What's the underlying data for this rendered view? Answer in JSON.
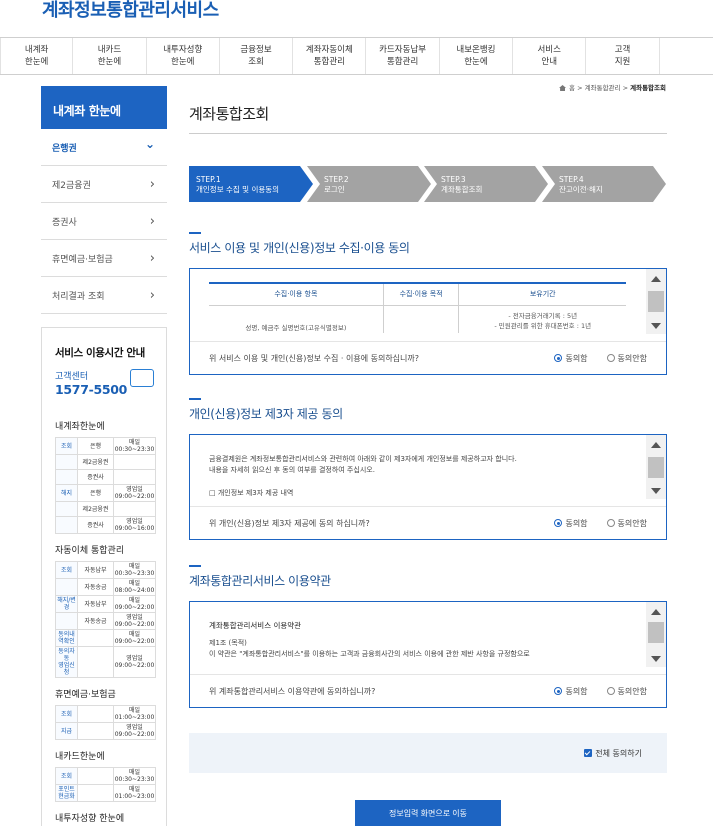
{
  "header": {
    "logo": "계좌정보통합관리서비스"
  },
  "gnb": [
    "내계좌\n한눈에",
    "내카드\n한눈에",
    "내투자성향\n한눈에",
    "금융정보\n조회",
    "계좌자동이체\n통합관리",
    "카드자동납부\n통합관리",
    "내보온뱅킹\n한눈에",
    "서비스\n안내",
    "고객\n지원"
  ],
  "lnb": {
    "title": "내계좌 한눈에",
    "items": [
      {
        "label": "은행권",
        "icon": "chevron-down"
      },
      {
        "label": "제2금융권",
        "icon": "chevron-right"
      },
      {
        "label": "증권사",
        "icon": "chevron-right"
      },
      {
        "label": "휴면예금·보험금",
        "icon": "chevron-right"
      },
      {
        "label": "처리결과 조회",
        "icon": "chevron-right"
      }
    ]
  },
  "service_info": {
    "title": "서비스 이용시간 안내",
    "cc_label": "고객센터",
    "cc_phone": "1577-5500",
    "sections": [
      {
        "title": "내계좌한눈에",
        "rows": [
          [
            "조회",
            "은행",
            "매일\n00:30~23:30"
          ],
          [
            "",
            "제2금융권",
            ""
          ],
          [
            "",
            "증권사",
            ""
          ],
          [
            "해지",
            "은행",
            "영업일\n09:00~22:00"
          ],
          [
            "",
            "제2금융권",
            ""
          ],
          [
            "",
            "증권사",
            "영업일\n09:00~16:00"
          ]
        ]
      },
      {
        "title": "자동이체 통합관리",
        "rows": [
          [
            "조회",
            "자동납부",
            "매일\n00:30~23:30"
          ],
          [
            "",
            "자동송금",
            "매일\n08:00~24:00"
          ],
          [
            "해지/변경",
            "자동납부",
            "매일\n09:00~22:00"
          ],
          [
            "",
            "자동송금",
            "영업일\n09:00~22:00"
          ],
          [
            "동의내역확인",
            "",
            "매일 09:00~22:00"
          ],
          [
            "동의자동\n영업신청",
            "",
            "영업일 09:00~22:00"
          ]
        ]
      },
      {
        "title": "휴면예금·보험금",
        "rows": [
          [
            "조회",
            "",
            "매일 01:00~23:00"
          ],
          [
            "지급",
            "",
            "영업일 09:00~22:00"
          ]
        ]
      },
      {
        "title": "내카드한눈에",
        "rows": [
          [
            "조회",
            "",
            "매일 00:30~23:30"
          ],
          [
            "포인트현금화",
            "",
            "매일 01:00~23:00"
          ]
        ]
      },
      {
        "title": "내투자성향 한눈에",
        "rows": []
      }
    ]
  },
  "breadcrumb": {
    "home": "홈",
    "mid": "계좌통합관리",
    "current": "계좌통합조회"
  },
  "page_title": "계좌통합조회",
  "steps": [
    {
      "num": "STEP.1",
      "label": "개인정보 수집 및 이용동의",
      "color": "#1d64c2"
    },
    {
      "num": "STEP.2",
      "label": "로그인",
      "color": "#a3a3a3"
    },
    {
      "num": "STEP.3",
      "label": "계좌통합조회",
      "color": "#a3a3a3"
    },
    {
      "num": "STEP.4",
      "label": "잔고이전·해지",
      "color": "#a3a3a3"
    }
  ],
  "section1": {
    "title": "서비스 이용 및 개인(신용)정보 수집·이용 동의",
    "table": {
      "headers": [
        "수집·이용 항목",
        "수집·이용 목적",
        "보유기간"
      ],
      "row": [
        "성명, 예금주 실명번호(고유식별정보)",
        "",
        "- 전자금융거래기록 : 5년\n- 민원관리를 위한 휴대폰번호 : 1년"
      ]
    },
    "question": "위 서비스 이용 및 개인(신용)정보 수집 · 이용에 동의하십니까?",
    "agree": "동의함",
    "disagree": "동의안함"
  },
  "section2": {
    "title": "개인(신용)정보 제3자 제공 동의",
    "body1": "금융결제원은 계좌정보통합관리서비스와 관련하여 아래와 같이 제3자에게 개인정보를 제공하고자 합니다.",
    "body2": "내용을 자세히 읽으신 후 동의 여부를 결정하여 주십시오.",
    "body3": "□ 개인정보 제3자 제공 내역",
    "question": "위 개인(신용)정보 제3자 제공에 동의 하십니까?",
    "agree": "동의함",
    "disagree": "동의안함"
  },
  "section3": {
    "title": "계좌통합관리서비스 이용약관",
    "body_title": "계좌통합관리서비스 이용약관",
    "body1": "제1조 (목적)",
    "body2": "이 약관은 \"계좌통합관리서비스\"를 이용하는 고객과 금융회사간의 서비스 이용에 관한 제반 사항을 규정함으로",
    "question": "위 계좌통합관리서비스 이용약관에 동의하십니까?",
    "agree": "동의함",
    "disagree": "동의안함"
  },
  "agree_all": "전체 동의하기",
  "go_button": "정보입력 화면으로 이동",
  "colors": {
    "primary": "#1d64c2",
    "step_inactive": "#a3a3a3",
    "agree_bg": "#eef3f9"
  }
}
